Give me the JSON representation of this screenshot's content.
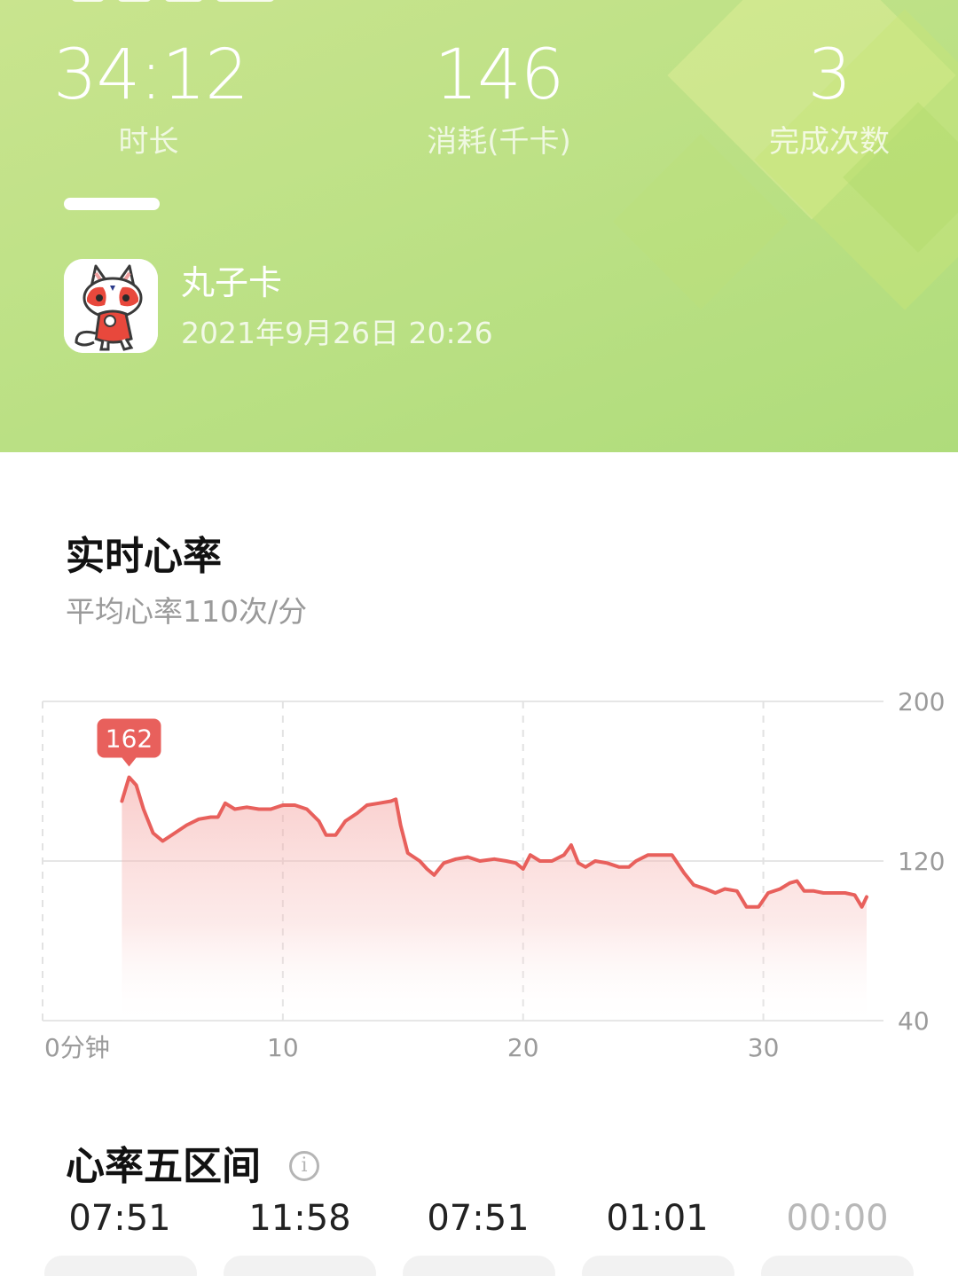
{
  "summary": {
    "stats": [
      {
        "value": "34:12",
        "label": "时长"
      },
      {
        "value": "146",
        "label": "消耗(千卡)"
      },
      {
        "value": "3",
        "label": "完成次数"
      }
    ]
  },
  "device": {
    "name": "丸子卡",
    "datetime": "2021年9月26日 20:26"
  },
  "heart_rate": {
    "title": "实时心率",
    "average": "平均心率110次/分",
    "peak_label": "162"
  },
  "chart_data": {
    "type": "area",
    "x_unit_label": "0分钟",
    "x_ticks": [
      "0分钟",
      "10",
      "20",
      "30"
    ],
    "y_ticks": [
      "200",
      "120",
      "40"
    ],
    "xlim": [
      0,
      35
    ],
    "ylim": [
      40,
      200
    ],
    "grid": true,
    "color": "#e8605c",
    "peak": {
      "x": 3.6,
      "y": 162
    },
    "points": [
      [
        3.3,
        150
      ],
      [
        3.6,
        162
      ],
      [
        3.9,
        158
      ],
      [
        4.2,
        146
      ],
      [
        4.6,
        134
      ],
      [
        5.0,
        130
      ],
      [
        5.5,
        134
      ],
      [
        6.0,
        138
      ],
      [
        6.5,
        141
      ],
      [
        7.0,
        142
      ],
      [
        7.3,
        142
      ],
      [
        7.6,
        149
      ],
      [
        8.0,
        146
      ],
      [
        8.5,
        147
      ],
      [
        9.0,
        146
      ],
      [
        9.5,
        146
      ],
      [
        10.0,
        148
      ],
      [
        10.5,
        148
      ],
      [
        11.0,
        146
      ],
      [
        11.5,
        140
      ],
      [
        11.8,
        133
      ],
      [
        12.2,
        133
      ],
      [
        12.6,
        140
      ],
      [
        13.1,
        144
      ],
      [
        13.5,
        148
      ],
      [
        14.0,
        149
      ],
      [
        14.5,
        150
      ],
      [
        14.7,
        151
      ],
      [
        14.9,
        138
      ],
      [
        15.2,
        124
      ],
      [
        15.7,
        120
      ],
      [
        16.0,
        116
      ],
      [
        16.3,
        113
      ],
      [
        16.7,
        119
      ],
      [
        17.2,
        121
      ],
      [
        17.7,
        122
      ],
      [
        18.2,
        120
      ],
      [
        18.8,
        121
      ],
      [
        19.3,
        120
      ],
      [
        19.7,
        119
      ],
      [
        20.0,
        116
      ],
      [
        20.3,
        123
      ],
      [
        20.7,
        120
      ],
      [
        21.2,
        120
      ],
      [
        21.7,
        123
      ],
      [
        22.0,
        128
      ],
      [
        22.3,
        119
      ],
      [
        22.6,
        117
      ],
      [
        23.0,
        120
      ],
      [
        23.5,
        119
      ],
      [
        24.0,
        117
      ],
      [
        24.4,
        117
      ],
      [
        24.7,
        120
      ],
      [
        25.2,
        123
      ],
      [
        25.6,
        123
      ],
      [
        26.2,
        123
      ],
      [
        26.7,
        114
      ],
      [
        27.1,
        108
      ],
      [
        27.6,
        106
      ],
      [
        28.0,
        104
      ],
      [
        28.4,
        106
      ],
      [
        28.9,
        105
      ],
      [
        29.3,
        97
      ],
      [
        29.8,
        97
      ],
      [
        30.2,
        104
      ],
      [
        30.7,
        106
      ],
      [
        31.1,
        109
      ],
      [
        31.4,
        110
      ],
      [
        31.7,
        105
      ],
      [
        32.1,
        105
      ],
      [
        32.5,
        104
      ],
      [
        32.9,
        104
      ],
      [
        33.4,
        104
      ],
      [
        33.8,
        103
      ],
      [
        34.1,
        97
      ],
      [
        34.3,
        102
      ]
    ]
  },
  "zones": {
    "title": "心率五区间",
    "times": [
      "07:51",
      "11:58",
      "07:51",
      "01:01",
      "00:00"
    ]
  },
  "colors": {
    "hero_green": "#bde186",
    "line_red": "#e8605c",
    "text_dark": "#111111",
    "text_muted": "#9a9a9a"
  }
}
